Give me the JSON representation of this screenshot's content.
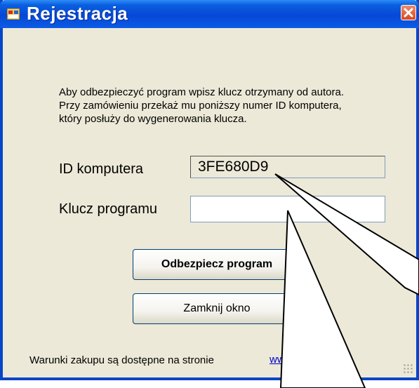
{
  "window": {
    "title": "Rejestracja"
  },
  "intro": {
    "lines": [
      "Aby odbezpieczyć program wpisz klucz otrzymany od autora.",
      "Przy zamówieniu przekaż mu poniższy numer ID komputera,",
      "który posłuży do wygenerowania klucza."
    ]
  },
  "form": {
    "id_label": "ID komputera",
    "id_value": "3FE680D9",
    "key_label": "Klucz programu",
    "key_value": ""
  },
  "buttons": {
    "unlock": "Odbezpiecz program",
    "close": "Zamknij okno"
  },
  "footer": {
    "text": "Warunki zakupu są dostępne na stronie",
    "link": "www.          us.net.pl"
  },
  "colors": {
    "titlebar": "#0747d6",
    "close_button": "#d9481f",
    "window_bg": "#ece9d8",
    "link": "#0000cc"
  },
  "icons": {
    "app": "window-app-icon",
    "close": "close-x-icon",
    "grip": "resize-grip-icon"
  }
}
